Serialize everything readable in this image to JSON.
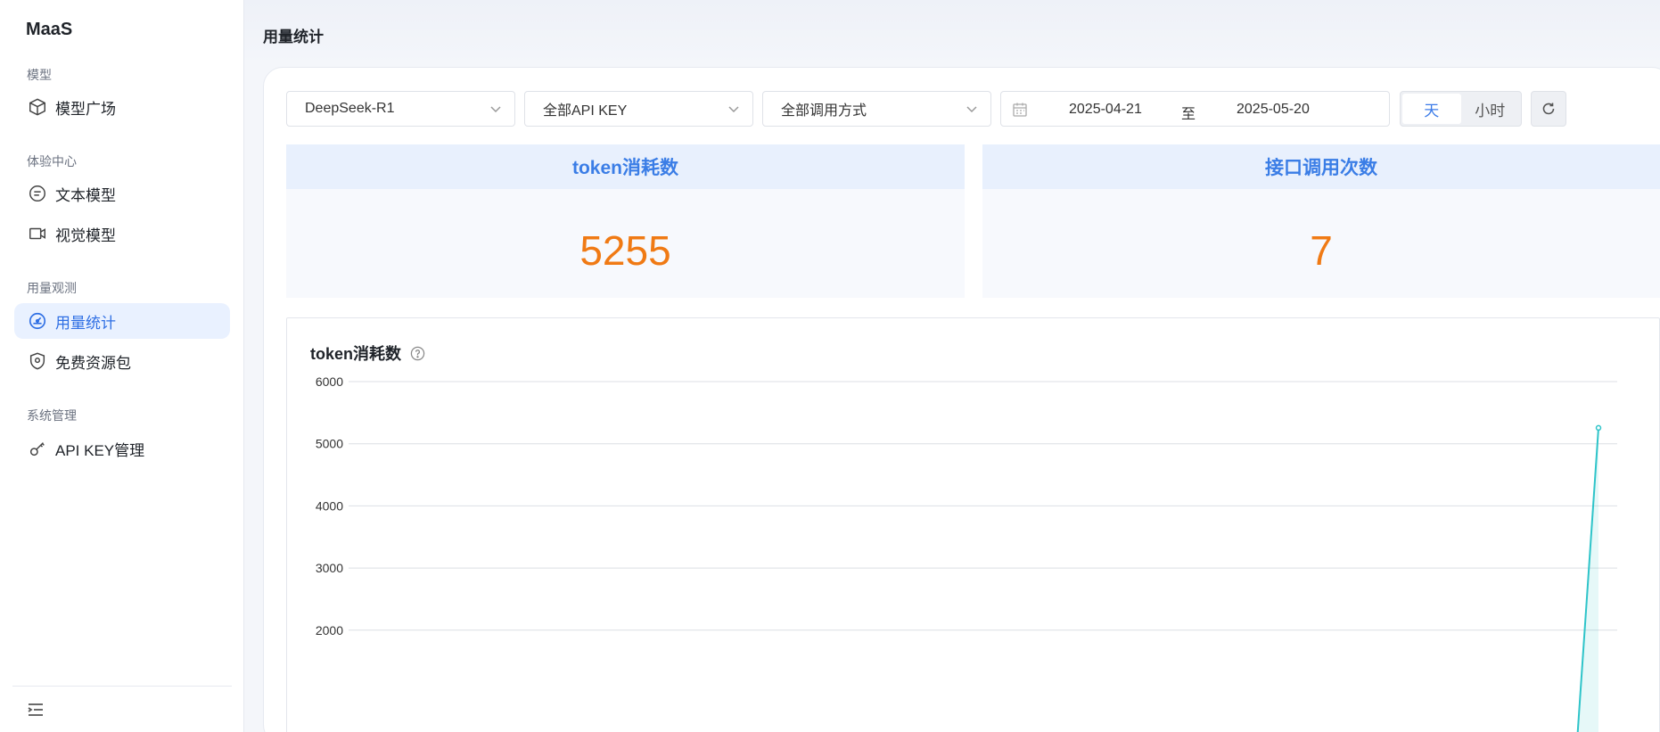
{
  "app": {
    "brand": "MaaS"
  },
  "sidebar": {
    "groups": [
      {
        "title": "模型",
        "items": [
          {
            "label": "模型广场",
            "icon": "cube-icon"
          }
        ]
      },
      {
        "title": "体验中心",
        "items": [
          {
            "label": "文本模型",
            "icon": "chat-bubble-icon"
          },
          {
            "label": "视觉模型",
            "icon": "video-camera-icon"
          }
        ]
      },
      {
        "title": "用量观测",
        "items": [
          {
            "label": "用量统计",
            "icon": "gauge-icon",
            "active": true
          },
          {
            "label": "免费资源包",
            "icon": "shield-icon"
          }
        ]
      },
      {
        "title": "系统管理",
        "items": [
          {
            "label": "API KEY管理",
            "icon": "key-icon"
          }
        ]
      }
    ]
  },
  "header": {
    "title": "用量统计"
  },
  "filters": {
    "model": "DeepSeek-R1",
    "api_key": "全部API KEY",
    "call_method": "全部调用方式",
    "date_start": "2025-04-21",
    "date_sep": "至",
    "date_end": "2025-05-20",
    "granularity": [
      {
        "label": "天",
        "selected": true
      },
      {
        "label": "小时",
        "selected": false
      }
    ]
  },
  "stats": {
    "tokens": {
      "title": "token消耗数",
      "value": "5255"
    },
    "calls": {
      "title": "接口调用次数",
      "value": "7"
    }
  },
  "colors": {
    "accent": "#3a7de6",
    "value": "#f07a14",
    "line": "#2ec4c9"
  },
  "chart_data": {
    "type": "line",
    "title": "token消耗数",
    "yticks": [
      2000,
      3000,
      4000,
      5000,
      6000
    ],
    "ylim": [
      0,
      6000
    ],
    "grid": true,
    "series": [
      {
        "values": [
          0,
          5255
        ]
      }
    ]
  }
}
